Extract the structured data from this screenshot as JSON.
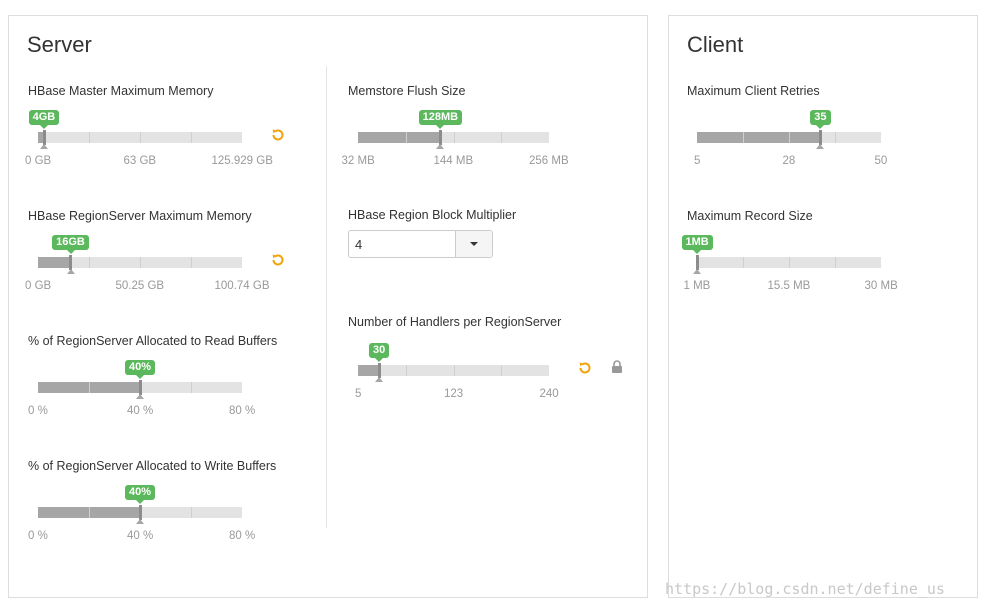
{
  "server": {
    "title": "Server",
    "fields": [
      {
        "label": "HBase Master Maximum Memory",
        "badge": "4GB",
        "fraction": 0.03,
        "scale": [
          "0 GB",
          "63 GB",
          "125.929 GB"
        ],
        "has_undo": true
      },
      {
        "label": "HBase RegionServer Maximum Memory",
        "badge": "16GB",
        "fraction": 0.16,
        "scale": [
          "0 GB",
          "50.25 GB",
          "100.74 GB"
        ],
        "has_undo": true
      },
      {
        "label": "% of RegionServer Allocated to Read Buffers",
        "badge": "40%",
        "fraction": 0.5,
        "scale": [
          "0 %",
          "40 %",
          "80 %"
        ],
        "has_undo": false
      },
      {
        "label": "% of RegionServer Allocated to Write Buffers",
        "badge": "40%",
        "fraction": 0.5,
        "scale": [
          "0 %",
          "40 %",
          "80 %"
        ],
        "has_undo": false
      },
      {
        "label": "Memstore Flush Size",
        "badge": "128MB",
        "fraction": 0.43,
        "scale": [
          "32 MB",
          "144 MB",
          "256 MB"
        ],
        "has_undo": false
      },
      {
        "label": "HBase Region Block Multiplier",
        "select_value": "4"
      },
      {
        "label": "Number of Handlers per RegionServer",
        "badge": "30",
        "fraction": 0.11,
        "scale": [
          "5",
          "123",
          "240"
        ],
        "has_undo": true,
        "has_lock": true
      }
    ]
  },
  "client": {
    "title": "Client",
    "fields": [
      {
        "label": "Maximum Client Retries",
        "badge": "35",
        "fraction": 0.67,
        "scale": [
          "5",
          "28",
          "50"
        ]
      },
      {
        "label": "Maximum Record Size",
        "badge": "1MB",
        "fraction": 0.0,
        "scale": [
          "1 MB",
          "15.5 MB",
          "30 MB"
        ]
      }
    ]
  },
  "colors": {
    "badge": "#5cb85c",
    "track": "#e3e3e3",
    "fill": "#a6a6a6",
    "undo": "#f0a30a",
    "lock": "#999999"
  },
  "icons": {
    "undo": "undo-icon",
    "lock": "lock-icon",
    "dropdown": "chevron-down-icon"
  },
  "watermark": "https://blog.csdn.net/define_us"
}
